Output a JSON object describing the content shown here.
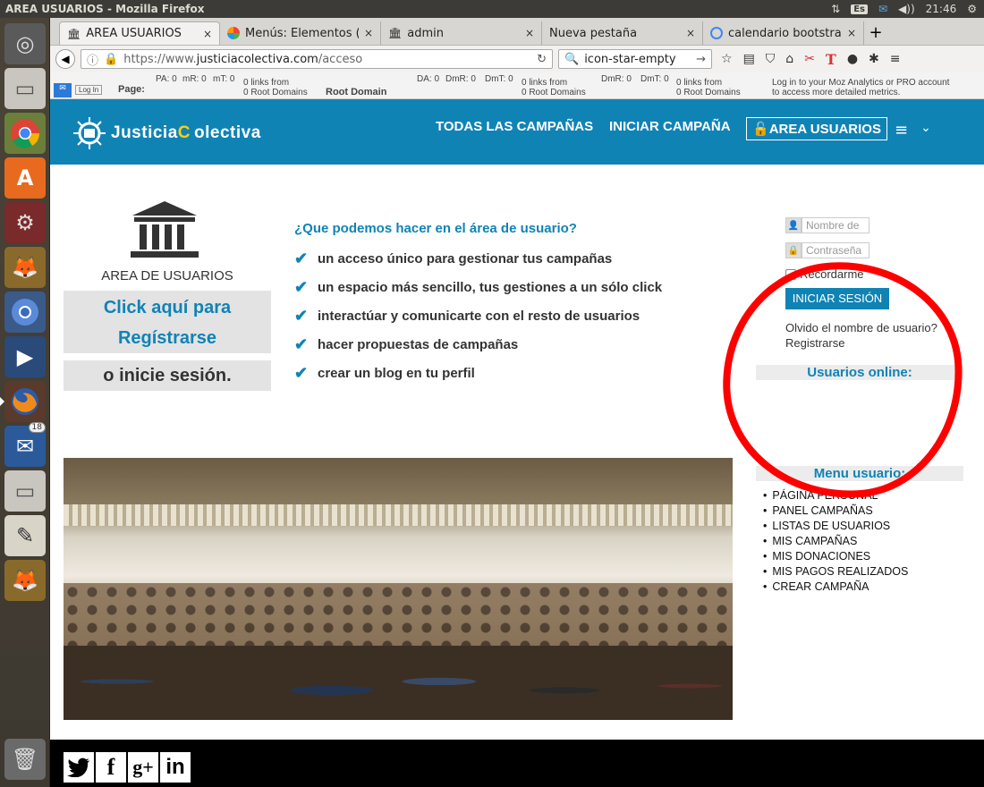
{
  "os": {
    "window_title": "AREA USUARIOS - Mozilla Firefox",
    "keyboard": "Es",
    "clock": "21:46"
  },
  "launcher": {
    "thunderbird_badge": "18"
  },
  "browser": {
    "tabs": [
      {
        "label": "AREA USUARIOS",
        "close": "×"
      },
      {
        "label": "Menús: Elementos (...",
        "close": "×"
      },
      {
        "label": "admin",
        "close": "×"
      },
      {
        "label": "Nueva pestaña",
        "close": "×"
      },
      {
        "label": "calendario bootstra...",
        "close": "×"
      }
    ],
    "new_tab": "+",
    "url_scheme": "https://www.",
    "url_domain": "justiciacolectiva.com",
    "url_path": "/acceso",
    "search_value": "icon-star-empty"
  },
  "mozbar": {
    "pa": "PA: 0",
    "mr": "mR: 0",
    "mt": "mT: 0",
    "links1_a": "0 links from",
    "links1_b": "0 Root Domains",
    "da": "DA: 0",
    "dmr": "DmR: 0",
    "dmt": "DmT: 0",
    "links2_a": "0 links from",
    "links2_b": "0 Root Domains",
    "dmr2": "DmR: 0",
    "dmt2": "DmT: 0",
    "links3_a": "0 links from",
    "links3_b": "0 Root Domains",
    "login_a": "Log in to your Moz Analytics or PRO account",
    "login_b": "to access more detailed metrics.",
    "page_label": "Page:",
    "root_domain": "Root Domain",
    "login_btn": "Log In"
  },
  "site": {
    "logo_part1": "Justicia ",
    "logo_part2": "C",
    "logo_part3": "olectiva",
    "nav": {
      "all_campaigns": "TODAS LAS CAMPAÑAS",
      "start_campaign": "INICIAR CAMPAÑA",
      "user_area": "AREA USUARIOS"
    },
    "area_title": "AREA DE USUARIOS",
    "register_line1": "Click aquí para",
    "register_line2": "Regístrarse",
    "or_login": "o inicie sesión.",
    "features_title": "¿Que podemos hacer en el área de usuario?",
    "features": [
      "un acceso único para gestionar tus campañas",
      "un espacio más sencillo, tus gestiones a un sólo click",
      "interactúar y comunicarte con el resto de usuarios",
      "hacer propuestas de campañas",
      "crear un blog en tu perfil"
    ],
    "login": {
      "username_placeholder": "Nombre de",
      "password_placeholder": "Contraseña",
      "remember": "Recordarme",
      "submit": "INICIAR SESIÓN",
      "forgot": "Olvido el nombre de usuario?",
      "register": "Registrarse"
    },
    "online_users_title": "Usuarios online:",
    "user_menu_title": "Menu usuario:",
    "user_menu": [
      "PÁGINA PERSONAL",
      "PANEL CAMPAÑAS",
      "LISTAS DE USUARIOS",
      "MIS CAMPAÑAS",
      "MIS DONACIONES",
      "MIS PAGOS REALIZADOS",
      "CREAR CAMPAÑA"
    ],
    "social": {
      "facebook": "f",
      "google": "g+",
      "linkedin": "in"
    }
  },
  "colors": {
    "brand_blue": "#1083b5",
    "logo_yellow": "#ffd000",
    "annotation_red": "#ff0000"
  }
}
